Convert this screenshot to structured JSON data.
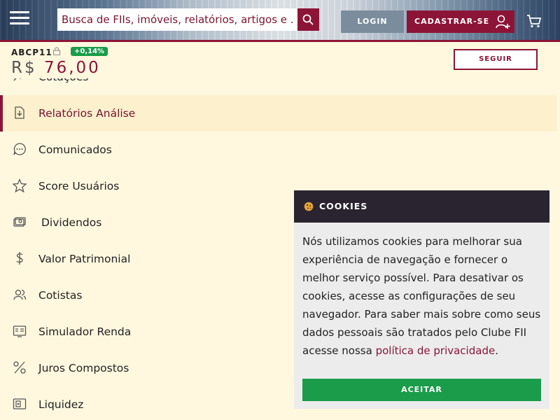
{
  "header": {
    "search_placeholder": "Busca de FIIs, imóveis, relatórios, artigos e ...",
    "login_label": "LOGIN",
    "register_label": "CADASTRAR-SE"
  },
  "ticker": {
    "code": "ABCP11",
    "change": "+0,14%",
    "currency": "R$",
    "price": "76,00",
    "follow_label": "SEGUIR"
  },
  "menu": {
    "items": [
      {
        "label": "Cotações",
        "icon": "chart-icon"
      },
      {
        "label": "Relatórios Análise",
        "icon": "download-doc-icon",
        "active": true
      },
      {
        "label": "Comunicados",
        "icon": "chat-icon"
      },
      {
        "label": "Score Usuários",
        "icon": "star-icon"
      },
      {
        "label": "Dividendos",
        "icon": "cash-icon"
      },
      {
        "label": "Valor Patrimonial",
        "icon": "dollar-icon"
      },
      {
        "label": "Cotistas",
        "icon": "users-icon"
      },
      {
        "label": "Simulador Renda",
        "icon": "calculator-icon"
      },
      {
        "label": "Juros Compostos",
        "icon": "percent-icon"
      },
      {
        "label": "Liquidez",
        "icon": "wallet-icon"
      }
    ]
  },
  "cookie": {
    "title": "COOKIES",
    "text": "Nós utilizamos cookies para melhorar sua experiência de navegação e fornecer o melhor serviço possível. Para desativar os cookies, acesse as configurações de seu navegador. Para saber mais sobre como seus dados pessoais são tratados pelo Clube FII acesse nossa ",
    "link": "política de privacidade",
    "after_link": ".",
    "accept_label": "ACEITAR"
  },
  "colors": {
    "brand": "#8c1537",
    "accept": "#1a9c4a",
    "background": "#fff8df"
  }
}
